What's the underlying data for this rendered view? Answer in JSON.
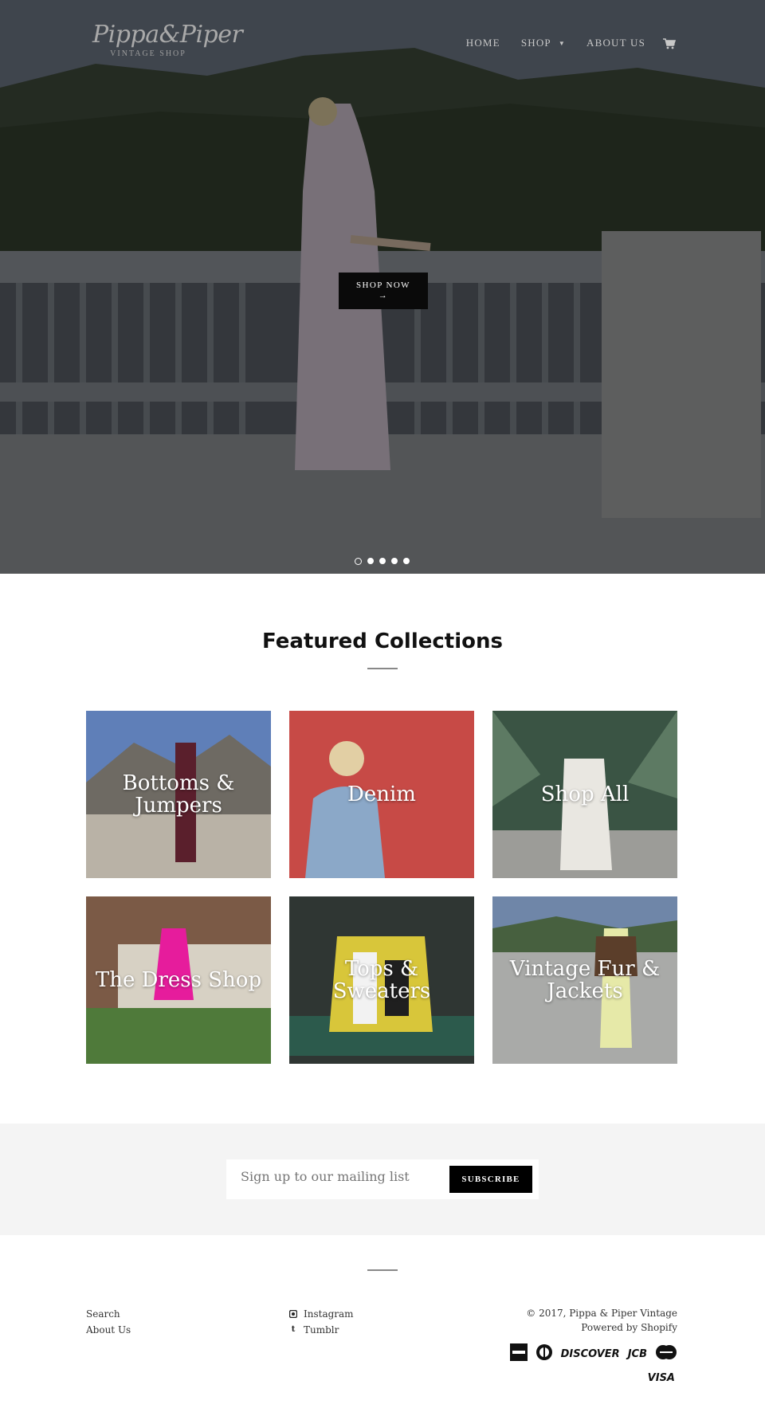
{
  "header": {
    "logo_script": "Pippa&Piper",
    "logo_sub": "VINTAGE SHOP",
    "nav": [
      {
        "label": "HOME"
      },
      {
        "label": "SHOP"
      },
      {
        "label": "ABOUT US"
      }
    ],
    "cart_icon": "cart-icon"
  },
  "hero": {
    "cta_label": "SHOP NOW",
    "cta_arrow": "→",
    "slides_count": 5,
    "active_slide": 1
  },
  "featured": {
    "title": "Featured Collections",
    "collections": [
      {
        "label": "Bottoms & Jumpers"
      },
      {
        "label": "Denim"
      },
      {
        "label": "Shop All"
      },
      {
        "label": "The Dress Shop"
      },
      {
        "label": "Tops & Sweaters"
      },
      {
        "label": "Vintage Fur & Jackets"
      }
    ]
  },
  "newsletter": {
    "placeholder": "Sign up to our mailing list",
    "button_label": "SUBSCRIBE"
  },
  "footer": {
    "links": [
      "Search",
      "About Us"
    ],
    "social": [
      {
        "label": "Instagram",
        "icon": "instagram-icon"
      },
      {
        "label": "Tumblr",
        "icon": "tumblr-icon"
      }
    ],
    "copyright": "© 2017, Pippa & Piper Vintage",
    "powered": "Powered by Shopify",
    "payments": [
      "AMEX",
      "Diners",
      "DISCOVER",
      "JCB",
      "MasterCard",
      "VISA"
    ]
  }
}
